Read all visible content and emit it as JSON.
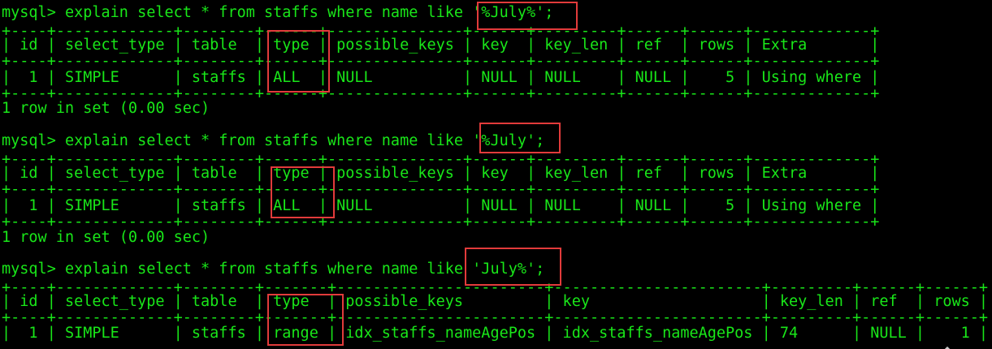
{
  "blocks": [
    {
      "prompt": "mysql>",
      "command": " explain select * from staffs where name like '%July%';",
      "border": "+----+-------------+--------+------+---------------+------+---------+------+------+-------------+",
      "header": "| id | select_type | table  | type | possible_keys | key  | key_len | ref  | rows | Extra       |",
      "row": "|  1 | SIMPLE      | staffs | ALL  | NULL          | NULL | NULL    | NULL |    5 | Using where |",
      "result": "1 row in set (0.00 sec)"
    },
    {
      "prompt": "mysql>",
      "command": " explain select * from staffs where name like '%July';",
      "border": "+----+-------------+--------+------+---------------+------+---------+------+------+-------------+",
      "header": "| id | select_type | table  | type | possible_keys | key  | key_len | ref  | rows | Extra       |",
      "row": "|  1 | SIMPLE      | staffs | ALL  | NULL          | NULL | NULL    | NULL |    5 | Using where |",
      "result": "1 row in set (0.00 sec)"
    },
    {
      "prompt": "mysql>",
      "command": " explain select * from staffs where name like 'July%';",
      "border": "+----+-------------+--------+-------+-----------------------+-----------------------+---------+------+------+",
      "header": "| id | select_type | table  | type  | possible_keys         | key                   | key_len | ref  | rows |",
      "row": "|  1 | SIMPLE      | staffs | range | idx_staffs_nameAgePos | idx_staffs_nameAgePos | 74      | NULL |    1 |"
    }
  ],
  "colors": {
    "background": "#000000",
    "text": "#19e619",
    "highlight": "#e23b3b"
  }
}
